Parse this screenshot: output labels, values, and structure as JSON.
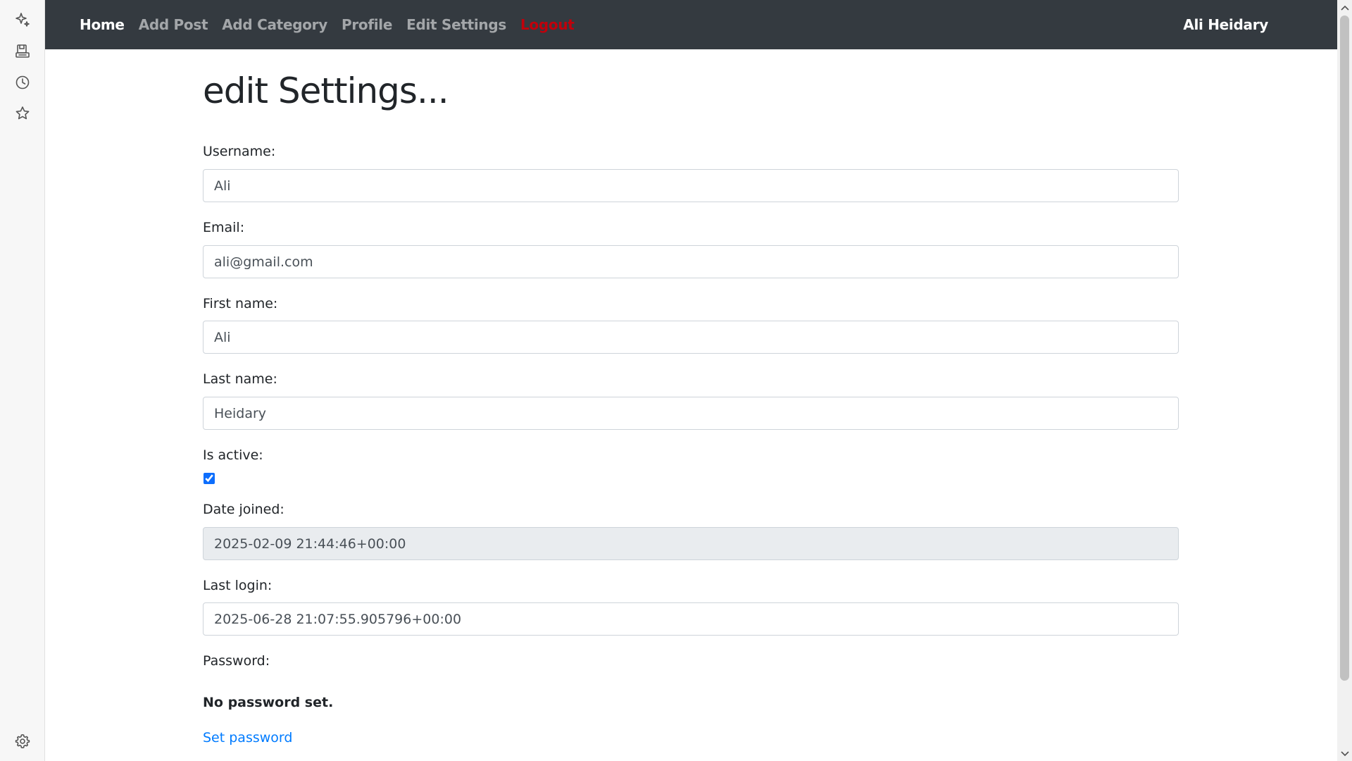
{
  "sidebar": {
    "icons": [
      "sparkle-icon",
      "media-icon",
      "history-icon",
      "favorites-star-icon",
      "settings-gear-icon"
    ]
  },
  "navbar": {
    "links": [
      {
        "label": "Home"
      },
      {
        "label": "Add Post"
      },
      {
        "label": "Add Category"
      },
      {
        "label": "Profile"
      },
      {
        "label": "Edit Settings"
      },
      {
        "label": "Logout"
      }
    ],
    "user": "Ali Heidary",
    "colors": {
      "background": "#343a40",
      "logout": "#c0000b"
    }
  },
  "page": {
    "title": "edit Settings..."
  },
  "form": {
    "username": {
      "label": "Username:",
      "value": "Ali"
    },
    "email": {
      "label": "Email:",
      "value": "ali@gmail.com"
    },
    "first_name": {
      "label": "First name:",
      "value": "Ali"
    },
    "last_name": {
      "label": "Last name:",
      "value": "Heidary"
    },
    "is_active": {
      "label": "Is active:",
      "checked": true
    },
    "date_joined": {
      "label": "Date joined:",
      "value": "2025-02-09 21:44:46+00:00"
    },
    "last_login": {
      "label": "Last login:",
      "value": "2025-06-28 21:07:55.905796+00:00"
    },
    "password": {
      "label": "Password:",
      "status": "No password set.",
      "link": "Set password"
    }
  },
  "colors": {
    "link": "#007bff",
    "readonly_bg": "#e9ecef"
  }
}
